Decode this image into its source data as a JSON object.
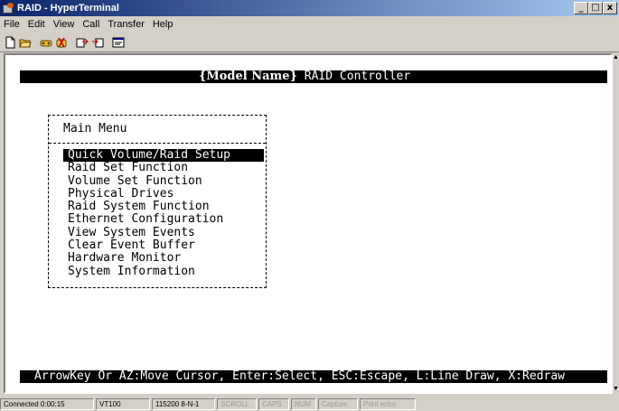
{
  "window": {
    "title": "RAID - HyperTerminal",
    "controls": {
      "minimize": "_",
      "maximize": "□",
      "close": "x"
    }
  },
  "menubar": {
    "items": [
      {
        "label": "File",
        "accel": "F"
      },
      {
        "label": "Edit",
        "accel": "E"
      },
      {
        "label": "View",
        "accel": "V"
      },
      {
        "label": "Call",
        "accel": "C"
      },
      {
        "label": "Transfer",
        "accel": "T"
      },
      {
        "label": "Help",
        "accel": "H"
      }
    ]
  },
  "toolbar": {
    "buttons": [
      "new-icon",
      "open-icon",
      "connect-icon",
      "disconnect-icon",
      "send-icon",
      "receive-icon",
      "properties-icon"
    ]
  },
  "terminal": {
    "header": {
      "model": "{Model Name}",
      "rest": " RAID Controller"
    },
    "menu_title": "Main Menu",
    "menu_items": [
      "Quick Volume/Raid Setup",
      "Raid Set Function",
      "Volume Set Function",
      "Physical Drives",
      "Raid System Function",
      "Ethernet Configuration",
      "View System Events",
      "Clear Event Buffer",
      "Hardware Monitor",
      "System Information"
    ],
    "selected_index": 0,
    "footer": "ArrowKey Or AZ:Move Cursor, Enter:Select, ESC:Escape, L:Line Draw, X:Redraw"
  },
  "statusbar": {
    "connected": "Connected 0:00:15",
    "emulation": "VT100",
    "settings": "115200 8-N-1",
    "scroll": "SCROLL",
    "caps": "CAPS",
    "num": "NUM",
    "capture": "Capture",
    "print_echo": "Print echo"
  },
  "colors": {
    "title_start": "#0a246a",
    "title_end": "#a6caf0",
    "terminal_bg": "#ffffff",
    "inverse_bg": "#000000"
  }
}
